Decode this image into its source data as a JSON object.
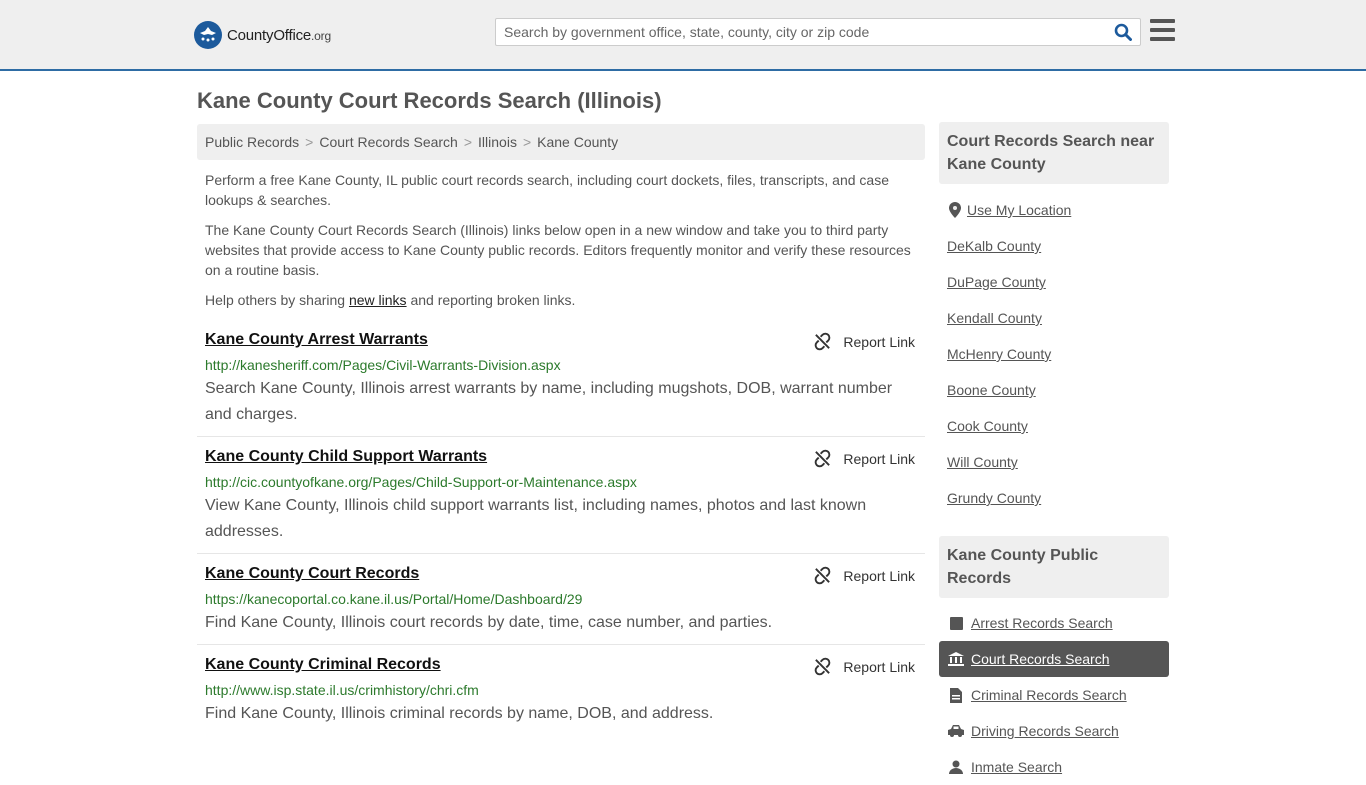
{
  "header": {
    "logo_main": "CountyOffice",
    "logo_ext": ".org",
    "search_placeholder": "Search by government office, state, county, city or zip code"
  },
  "page_title": "Kane County Court Records Search (Illinois)",
  "breadcrumb": [
    "Public Records",
    "Court Records Search",
    "Illinois",
    "Kane County"
  ],
  "intro": {
    "p1": "Perform a free Kane County, IL public court records search, including court dockets, files, transcripts, and case lookups & searches.",
    "p2": "The Kane County Court Records Search (Illinois) links below open in a new window and take you to third party websites that provide access to Kane County public records. Editors frequently monitor and verify these resources on a routine basis.",
    "p3_before": "Help others by sharing ",
    "p3_link": "new links",
    "p3_after": " and reporting broken links."
  },
  "report_label": "Report Link",
  "results": [
    {
      "title": "Kane County Arrest Warrants",
      "url": "http://kanesheriff.com/Pages/Civil-Warrants-Division.aspx",
      "desc": "Search Kane County, Illinois arrest warrants by name, including mugshots, DOB, warrant number and charges."
    },
    {
      "title": "Kane County Child Support Warrants",
      "url": "http://cic.countyofkane.org/Pages/Child-Support-or-Maintenance.aspx",
      "desc": "View Kane County, Illinois child support warrants list, including names, photos and last known addresses."
    },
    {
      "title": "Kane County Court Records",
      "url": "https://kanecoportal.co.kane.il.us/Portal/Home/Dashboard/29",
      "desc": "Find Kane County, Illinois court records by date, time, case number, and parties."
    },
    {
      "title": "Kane County Criminal Records",
      "url": "http://www.isp.state.il.us/crimhistory/chri.cfm",
      "desc": "Find Kane County, Illinois criminal records by name, DOB, and address."
    }
  ],
  "sidebar": {
    "near_heading": "Court Records Search near Kane County",
    "use_location": "Use My Location",
    "counties": [
      "DeKalb County",
      "DuPage County",
      "Kendall County",
      "McHenry County",
      "Boone County",
      "Cook County",
      "Will County",
      "Grundy County"
    ],
    "public_heading": "Kane County Public Records",
    "public_links": [
      {
        "label": "Arrest Records Search",
        "icon": "square-icon",
        "active": false
      },
      {
        "label": "Court Records Search",
        "icon": "courthouse-icon",
        "active": true
      },
      {
        "label": "Criminal Records Search",
        "icon": "file-icon",
        "active": false
      },
      {
        "label": "Driving Records Search",
        "icon": "car-icon",
        "active": false
      },
      {
        "label": "Inmate Search",
        "icon": "user-icon",
        "active": false
      }
    ]
  },
  "colors": {
    "header_bg": "#efefef",
    "header_border": "#2e6ca4",
    "url_green": "#2c7a2c",
    "active_bg": "#555555",
    "brand_blue": "#1c5a9c"
  }
}
